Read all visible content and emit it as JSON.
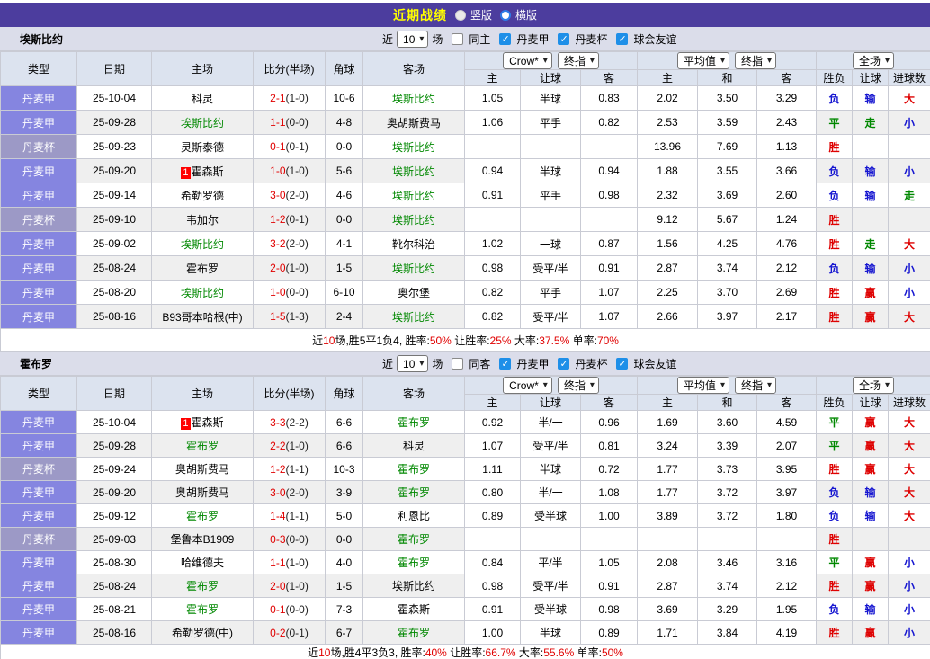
{
  "title_bar": {
    "title": "近期战绩",
    "vertical_label": "竖版",
    "horizontal_label": "横版"
  },
  "filters": {
    "near_label": "近",
    "count_value": "10",
    "matches_label": "场",
    "league_label": "丹麦甲",
    "cup_label": "丹麦杯",
    "friendly_label": "球会友谊"
  },
  "headers": {
    "type": "类型",
    "date": "日期",
    "home": "主场",
    "score": "比分(半场)",
    "corner": "角球",
    "away": "客场",
    "crow": "Crow*",
    "final": "终指",
    "avg": "平均值",
    "full": "全场",
    "h": "主",
    "hcp": "让球",
    "a": "客",
    "draw": "和",
    "result": "胜负",
    "hcp_result": "让球",
    "goals": "进球数"
  },
  "colors": {
    "title_bar_bg": "#4C3D9E",
    "title_text": "#FFFF00",
    "league_cell_bg": "#8585E0",
    "cup_cell_bg": "#9C99C6",
    "crow_col_bg": "#FBF4E8",
    "avg_col_bg": "#EAF3FA",
    "win_red": "#DE0000",
    "draw_green": "#008800",
    "lose_blue": "#1515D0",
    "highlight_team_green": "#008800",
    "checkbox_blue": "#1E8FE8"
  },
  "sections": [
    {
      "team": "埃斯比约",
      "same_label": "同主",
      "rows": [
        {
          "type": "丹麦甲",
          "date": "25-10-04",
          "home": "科灵",
          "home_hl": false,
          "home_badge": null,
          "score": "2-1",
          "half": "(1-0)",
          "corner": "10-6",
          "away": "埃斯比约",
          "away_hl": true,
          "crow": [
            "1.05",
            "半球",
            "0.83"
          ],
          "avg": [
            "2.02",
            "3.50",
            "3.29"
          ],
          "res": [
            "负",
            "输",
            "大"
          ]
        },
        {
          "type": "丹麦甲",
          "date": "25-09-28",
          "home": "埃斯比约",
          "home_hl": true,
          "home_badge": null,
          "score": "1-1",
          "half": "(0-0)",
          "corner": "4-8",
          "away": "奥胡斯费马",
          "away_hl": false,
          "crow": [
            "1.06",
            "平手",
            "0.82"
          ],
          "avg": [
            "2.53",
            "3.59",
            "2.43"
          ],
          "res": [
            "平",
            "走",
            "小"
          ]
        },
        {
          "type": "丹麦杯",
          "date": "25-09-23",
          "home": "灵斯泰德",
          "home_hl": false,
          "home_badge": null,
          "score": "0-1",
          "half": "(0-1)",
          "corner": "0-0",
          "away": "埃斯比约",
          "away_hl": true,
          "crow": [
            "",
            "",
            ""
          ],
          "avg": [
            "13.96",
            "7.69",
            "1.13"
          ],
          "res": [
            "胜",
            "",
            ""
          ]
        },
        {
          "type": "丹麦甲",
          "date": "25-09-20",
          "home": "霍森斯",
          "home_hl": false,
          "home_badge": "1",
          "score": "1-0",
          "half": "(1-0)",
          "corner": "5-6",
          "away": "埃斯比约",
          "away_hl": true,
          "crow": [
            "0.94",
            "半球",
            "0.94"
          ],
          "avg": [
            "1.88",
            "3.55",
            "3.66"
          ],
          "res": [
            "负",
            "输",
            "小"
          ]
        },
        {
          "type": "丹麦甲",
          "date": "25-09-14",
          "home": "希勒罗德",
          "home_hl": false,
          "home_badge": null,
          "score": "3-0",
          "half": "(2-0)",
          "corner": "4-6",
          "away": "埃斯比约",
          "away_hl": true,
          "crow": [
            "0.91",
            "平手",
            "0.98"
          ],
          "avg": [
            "2.32",
            "3.69",
            "2.60"
          ],
          "res": [
            "负",
            "输",
            "走"
          ]
        },
        {
          "type": "丹麦杯",
          "date": "25-09-10",
          "home": "韦加尔",
          "home_hl": false,
          "home_badge": null,
          "score": "1-2",
          "half": "(0-1)",
          "corner": "0-0",
          "away": "埃斯比约",
          "away_hl": true,
          "crow": [
            "",
            "",
            ""
          ],
          "avg": [
            "9.12",
            "5.67",
            "1.24"
          ],
          "res": [
            "胜",
            "",
            ""
          ]
        },
        {
          "type": "丹麦甲",
          "date": "25-09-02",
          "home": "埃斯比约",
          "home_hl": true,
          "home_badge": null,
          "score": "3-2",
          "half": "(2-0)",
          "corner": "4-1",
          "away": "靴尔科治",
          "away_hl": false,
          "crow": [
            "1.02",
            "一球",
            "0.87"
          ],
          "avg": [
            "1.56",
            "4.25",
            "4.76"
          ],
          "res": [
            "胜",
            "走",
            "大"
          ]
        },
        {
          "type": "丹麦甲",
          "date": "25-08-24",
          "home": "霍布罗",
          "home_hl": false,
          "home_badge": null,
          "score": "2-0",
          "half": "(1-0)",
          "corner": "1-5",
          "away": "埃斯比约",
          "away_hl": true,
          "crow": [
            "0.98",
            "受平/半",
            "0.91"
          ],
          "avg": [
            "2.87",
            "3.74",
            "2.12"
          ],
          "res": [
            "负",
            "输",
            "小"
          ]
        },
        {
          "type": "丹麦甲",
          "date": "25-08-20",
          "home": "埃斯比约",
          "home_hl": true,
          "home_badge": null,
          "score": "1-0",
          "half": "(0-0)",
          "corner": "6-10",
          "away": "奥尔堡",
          "away_hl": false,
          "crow": [
            "0.82",
            "平手",
            "1.07"
          ],
          "avg": [
            "2.25",
            "3.70",
            "2.69"
          ],
          "res": [
            "胜",
            "赢",
            "小"
          ]
        },
        {
          "type": "丹麦甲",
          "date": "25-08-16",
          "home": "B93哥本哈根(中)",
          "home_hl": false,
          "home_badge": null,
          "score": "1-5",
          "half": "(1-3)",
          "corner": "2-4",
          "away": "埃斯比约",
          "away_hl": true,
          "crow": [
            "0.82",
            "受平/半",
            "1.07"
          ],
          "avg": [
            "2.66",
            "3.97",
            "2.17"
          ],
          "res": [
            "胜",
            "赢",
            "大"
          ]
        }
      ],
      "summary": [
        [
          "近",
          false
        ],
        [
          "10",
          true
        ],
        [
          "场,胜5平1负4, 胜率:",
          false
        ],
        [
          "50%",
          true
        ],
        [
          " 让胜率:",
          false
        ],
        [
          "25%",
          true
        ],
        [
          " 大率:",
          false
        ],
        [
          "37.5%",
          true
        ],
        [
          " 单率:",
          false
        ],
        [
          "70%",
          true
        ]
      ]
    },
    {
      "team": "霍布罗",
      "same_label": "同客",
      "rows": [
        {
          "type": "丹麦甲",
          "date": "25-10-04",
          "home": "霍森斯",
          "home_hl": false,
          "home_badge": "1",
          "score": "3-3",
          "half": "(2-2)",
          "corner": "6-6",
          "away": "霍布罗",
          "away_hl": true,
          "crow": [
            "0.92",
            "半/一",
            "0.96"
          ],
          "avg": [
            "1.69",
            "3.60",
            "4.59"
          ],
          "res": [
            "平",
            "赢",
            "大"
          ]
        },
        {
          "type": "丹麦甲",
          "date": "25-09-28",
          "home": "霍布罗",
          "home_hl": true,
          "home_badge": null,
          "score": "2-2",
          "half": "(1-0)",
          "corner": "6-6",
          "away": "科灵",
          "away_hl": false,
          "crow": [
            "1.07",
            "受平/半",
            "0.81"
          ],
          "avg": [
            "3.24",
            "3.39",
            "2.07"
          ],
          "res": [
            "平",
            "赢",
            "大"
          ]
        },
        {
          "type": "丹麦杯",
          "date": "25-09-24",
          "home": "奥胡斯费马",
          "home_hl": false,
          "home_badge": null,
          "score": "1-2",
          "half": "(1-1)",
          "corner": "10-3",
          "away": "霍布罗",
          "away_hl": true,
          "crow": [
            "1.11",
            "半球",
            "0.72"
          ],
          "avg": [
            "1.77",
            "3.73",
            "3.95"
          ],
          "res": [
            "胜",
            "赢",
            "大"
          ]
        },
        {
          "type": "丹麦甲",
          "date": "25-09-20",
          "home": "奥胡斯费马",
          "home_hl": false,
          "home_badge": null,
          "score": "3-0",
          "half": "(2-0)",
          "corner": "3-9",
          "away": "霍布罗",
          "away_hl": true,
          "crow": [
            "0.80",
            "半/一",
            "1.08"
          ],
          "avg": [
            "1.77",
            "3.72",
            "3.97"
          ],
          "res": [
            "负",
            "输",
            "大"
          ]
        },
        {
          "type": "丹麦甲",
          "date": "25-09-12",
          "home": "霍布罗",
          "home_hl": true,
          "home_badge": null,
          "score": "1-4",
          "half": "(1-1)",
          "corner": "5-0",
          "away": "利恩比",
          "away_hl": false,
          "crow": [
            "0.89",
            "受半球",
            "1.00"
          ],
          "avg": [
            "3.89",
            "3.72",
            "1.80"
          ],
          "res": [
            "负",
            "输",
            "大"
          ]
        },
        {
          "type": "丹麦杯",
          "date": "25-09-03",
          "home": "堡鲁本B1909",
          "home_hl": false,
          "home_badge": null,
          "score": "0-3",
          "half": "(0-0)",
          "corner": "0-0",
          "away": "霍布罗",
          "away_hl": true,
          "crow": [
            "",
            "",
            ""
          ],
          "avg": [
            "",
            "",
            ""
          ],
          "res": [
            "胜",
            "",
            ""
          ]
        },
        {
          "type": "丹麦甲",
          "date": "25-08-30",
          "home": "哈维德夫",
          "home_hl": false,
          "home_badge": null,
          "score": "1-1",
          "half": "(1-0)",
          "corner": "4-0",
          "away": "霍布罗",
          "away_hl": true,
          "crow": [
            "0.84",
            "平/半",
            "1.05"
          ],
          "avg": [
            "2.08",
            "3.46",
            "3.16"
          ],
          "res": [
            "平",
            "赢",
            "小"
          ]
        },
        {
          "type": "丹麦甲",
          "date": "25-08-24",
          "home": "霍布罗",
          "home_hl": true,
          "home_badge": null,
          "score": "2-0",
          "half": "(1-0)",
          "corner": "1-5",
          "away": "埃斯比约",
          "away_hl": false,
          "crow": [
            "0.98",
            "受平/半",
            "0.91"
          ],
          "avg": [
            "2.87",
            "3.74",
            "2.12"
          ],
          "res": [
            "胜",
            "赢",
            "小"
          ]
        },
        {
          "type": "丹麦甲",
          "date": "25-08-21",
          "home": "霍布罗",
          "home_hl": true,
          "home_badge": null,
          "score": "0-1",
          "half": "(0-0)",
          "corner": "7-3",
          "away": "霍森斯",
          "away_hl": false,
          "crow": [
            "0.91",
            "受半球",
            "0.98"
          ],
          "avg": [
            "3.69",
            "3.29",
            "1.95"
          ],
          "res": [
            "负",
            "输",
            "小"
          ]
        },
        {
          "type": "丹麦甲",
          "date": "25-08-16",
          "home": "希勒罗德(中)",
          "home_hl": false,
          "home_badge": null,
          "score": "0-2",
          "half": "(0-1)",
          "corner": "6-7",
          "away": "霍布罗",
          "away_hl": true,
          "crow": [
            "1.00",
            "半球",
            "0.89"
          ],
          "avg": [
            "1.71",
            "3.84",
            "4.19"
          ],
          "res": [
            "胜",
            "赢",
            "小"
          ]
        }
      ],
      "summary": [
        [
          "近",
          false
        ],
        [
          "10",
          true
        ],
        [
          "场,胜4平3负3, 胜率:",
          false
        ],
        [
          "40%",
          true
        ],
        [
          " 让胜率:",
          false
        ],
        [
          "66.7%",
          true
        ],
        [
          " 大率:",
          false
        ],
        [
          "55.6%",
          true
        ],
        [
          " 单率:",
          false
        ],
        [
          "50%",
          true
        ]
      ]
    }
  ]
}
